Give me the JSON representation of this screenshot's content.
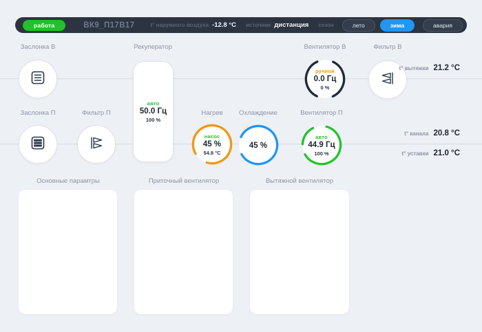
{
  "header": {
    "status_badge": "работа",
    "title": "ВК9_П17В17",
    "outdoor_temp_label": "t° наружного воздуха",
    "outdoor_temp_value": "-12.8 °C",
    "source_label": "источник",
    "source_value": "дистанция",
    "season_label": "сезон",
    "season_summer": "лето",
    "season_winter": "зима",
    "alarm_button": "авария"
  },
  "diagram": {
    "damper_exhaust": {
      "label": "Заслонка В"
    },
    "recuperator": {
      "label": "Рекуператор",
      "mode": "авто",
      "frequency": "50.0 Гц",
      "percent": "100 %"
    },
    "fan_exhaust": {
      "label": "Вентилятор В",
      "mode": "ручной",
      "frequency": "0.0 Гц",
      "percent": "0 %"
    },
    "filter_exhaust": {
      "label": "Фильтр В"
    },
    "exhaust_temp": {
      "label": "t° вытяжки",
      "value": "21.2 °C"
    },
    "damper_supply": {
      "label": "Заслонка П"
    },
    "filter_supply": {
      "label": "Фильтр П"
    },
    "heating": {
      "label": "Нагрев",
      "mode": "насос",
      "percent": "45 %",
      "temp": "54.8 °C"
    },
    "cooling": {
      "label": "Охлаждение",
      "percent": "45 %"
    },
    "fan_supply": {
      "label": "Вентилятор П",
      "mode": "авто",
      "frequency": "44.9 Гц",
      "percent": "100 %"
    },
    "channel_temp": {
      "label": "t° канала",
      "value": "20.8 °C"
    },
    "setpoint_temp": {
      "label": "t° уставки",
      "value": "21.0 °C"
    }
  },
  "panels": [
    {
      "title": "Основные парамтры"
    },
    {
      "title": "Приточный вентилятор"
    },
    {
      "title": "Вытяжной вентилятор"
    }
  ],
  "colors": {
    "run_green": "#1ec32a",
    "winter_blue": "#2196f3",
    "manual_orange": "#f0980f",
    "topbar_dark": "#2b3440",
    "fan_exhaust_ring": "#222b38",
    "background": "#edf0f5"
  }
}
